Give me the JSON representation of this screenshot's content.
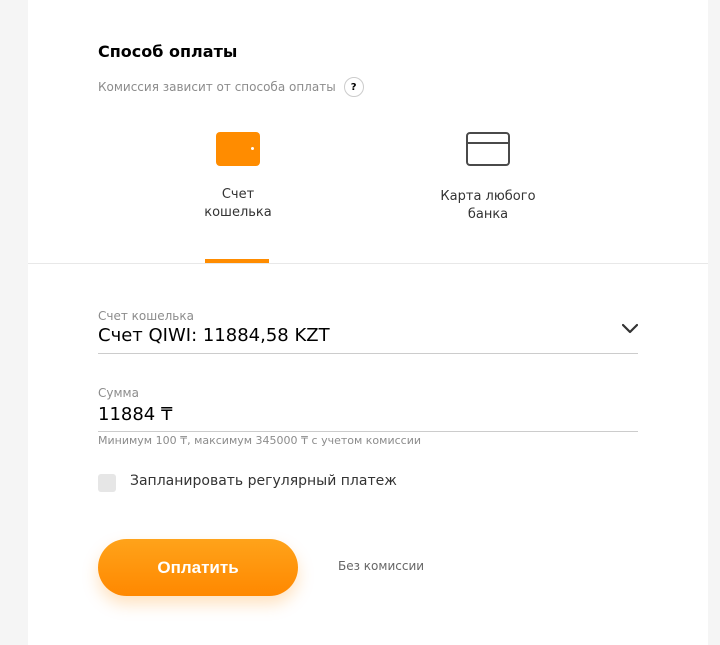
{
  "header": {
    "title": "Способ оплаты",
    "subtitle": "Комиссия зависит от способа оплаты",
    "help_icon": "?"
  },
  "tabs": [
    {
      "label": "Счет\nкошелька",
      "icon": "wallet-icon",
      "active": true
    },
    {
      "label": "Карта любого\nбанка",
      "icon": "credit-card-icon",
      "active": false
    }
  ],
  "account": {
    "label": "Счет кошелька",
    "value": "Счет QIWI: 11884,58 KZT"
  },
  "amount": {
    "label": "Сумма",
    "value": "11884 ₸",
    "hint": "Минимум 100 ₸, максимум 345000 ₸ с учетом комиссии"
  },
  "schedule": {
    "label": "Запланировать регулярный платеж"
  },
  "actions": {
    "pay_label": "Оплатить",
    "fee_note": "Без комиссии"
  },
  "colors": {
    "accent": "#ff8c00"
  }
}
